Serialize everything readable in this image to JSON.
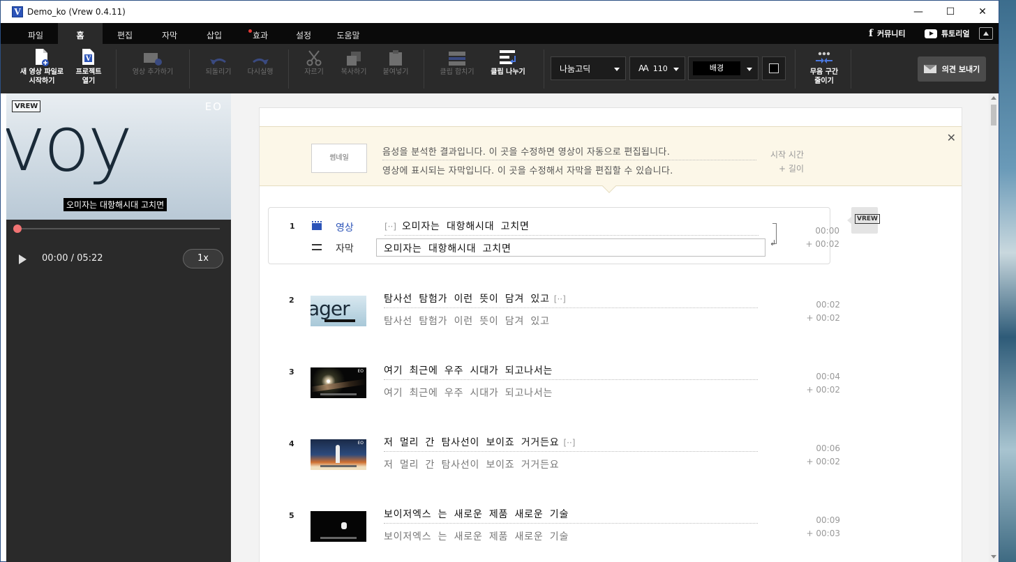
{
  "window": {
    "title": "Demo_ko (Vrew 0.4.11)",
    "app_icon_glyph": "V",
    "controls": [
      "—",
      "☐",
      "✕"
    ]
  },
  "menu": {
    "tabs": [
      "파일",
      "홈",
      "편집",
      "자막",
      "삽입",
      "효과",
      "설정",
      "도움말"
    ],
    "active": "홈",
    "community": "커뮤니티",
    "tutorial": "튜토리얼"
  },
  "toolbar": {
    "new_project_1": "새 영상 파일로",
    "new_project_2": "시작하기",
    "open_project_1": "프로젝트",
    "open_project_2": "열기",
    "add_video": "영상 추가하기",
    "undo": "되돌리기",
    "redo": "다시실행",
    "cut": "자르기",
    "copy": "복사하기",
    "paste": "붙여넣기",
    "merge_clip": "클립 합치기",
    "split_clip": "클립 나누기",
    "font": "나눔고딕",
    "font_size_icon": "AA",
    "font_size": "110",
    "background": "배경",
    "silence_1": "무음 구간",
    "silence_2": "줄이기",
    "feedback": "의견 보내기"
  },
  "player": {
    "logo": "VREW",
    "watermark": "EO",
    "preview_text": "voy",
    "subtitle": "오미자는 대항해시대 고치면",
    "timecode": "00:00 / 05:22",
    "speed": "1x",
    "progress": 0.0
  },
  "guide": {
    "thumbnail": "썸네일",
    "line1": "음성을 분석한 결과입니다. 이 곳을 수정하면 영상이 자동으로 편집됩니다.",
    "line2": "영상에 표시되는 자막입니다. 이 곳을 수정해서 자막을 편집할 수 있습니다.",
    "start_time": "시작 시간",
    "length": "+ 길이",
    "close": "✕"
  },
  "clips": [
    {
      "num": "1",
      "video_label": "영상",
      "subtitle_label": "자막",
      "dots_before": "[··]",
      "orig": "오미자는 대항해시대 고치면",
      "sub": "오미자는 대항해시대 고치면",
      "start": "00:00",
      "length": "+ 00:02"
    },
    {
      "num": "2",
      "thumb_text": "ager",
      "orig": "탐사선 탐험가 이런 뜻이 담겨 있고",
      "dots_after": "[··]",
      "sub": "탐사선 탐험가 이런 뜻이 담겨 있고",
      "start": "00:02",
      "length": "+ 00:02"
    },
    {
      "num": "3",
      "orig": "여기 최근에 우주 시대가 되고나서는",
      "sub": "여기 최근에 우주 시대가 되고나서는",
      "start": "00:04",
      "length": "+ 00:02"
    },
    {
      "num": "4",
      "orig": "저 멀리 간 탐사선이 보이죠 거거든요",
      "dots_after": "[··]",
      "sub": "저 멀리 간 탐사선이 보이죠 거거든요",
      "start": "00:06",
      "length": "+ 00:02"
    },
    {
      "num": "5",
      "orig": "보이저엑스 는 새로운 제품 새로운 기술",
      "sub": "보이저엑스 는 새로운 제품 새로운 기술",
      "start": "00:09",
      "length": "+ 00:03"
    }
  ],
  "side_logo": "VREW",
  "colors": {
    "accent": "#2c54b8",
    "menubar": "#0a0a0a",
    "toolbar": "#2a2a2a",
    "guide_bg": "#fcf7e8",
    "progress_knob": "#f07373"
  }
}
